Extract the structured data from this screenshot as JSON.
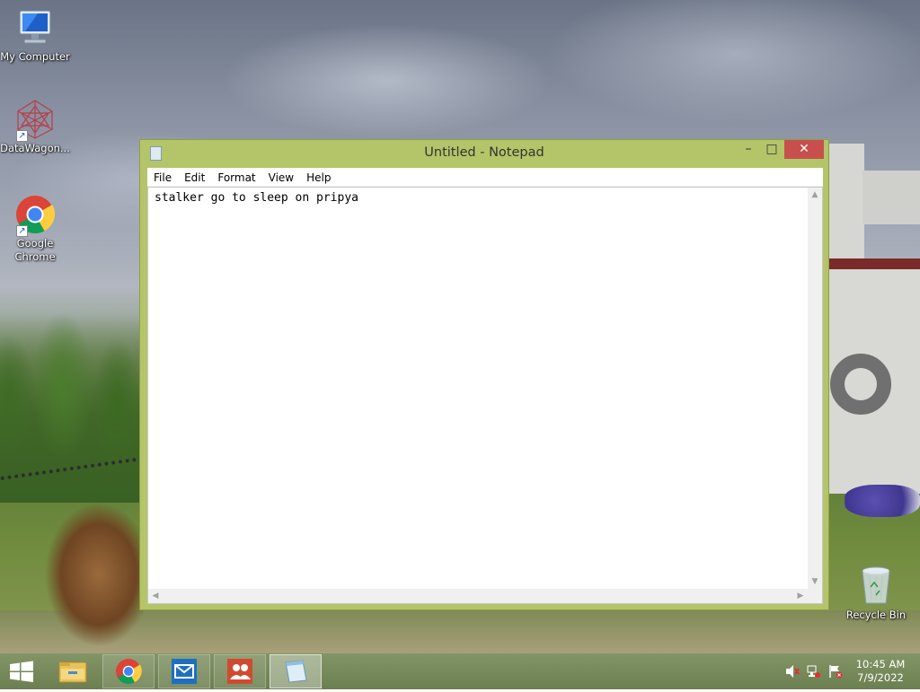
{
  "desktop": {
    "icons": [
      {
        "label": "My Computer",
        "icon": "computer-icon"
      },
      {
        "label": "DataWagon...",
        "icon": "datawagon-icon"
      },
      {
        "label": "Google Chrome",
        "icon": "chrome-icon"
      },
      {
        "label": "Recycle Bin",
        "icon": "recycle-bin-icon"
      }
    ]
  },
  "window": {
    "title": "Untitled - Notepad",
    "controls": {
      "minimize": "–",
      "maximize": "□",
      "close": "✕"
    },
    "menu": [
      "File",
      "Edit",
      "Format",
      "View",
      "Help"
    ],
    "content": "stalker go to sleep on pripya",
    "frame_color": "#b4c468",
    "close_color": "#c7504d"
  },
  "taskbar": {
    "apps": [
      "start",
      "file-explorer",
      "google-chrome",
      "mail",
      "people",
      "notepad"
    ],
    "tray": [
      "volume-muted-icon",
      "network-icon",
      "action-center-flag-icon"
    ],
    "time": "10:45 AM",
    "date": "7/9/2022"
  }
}
